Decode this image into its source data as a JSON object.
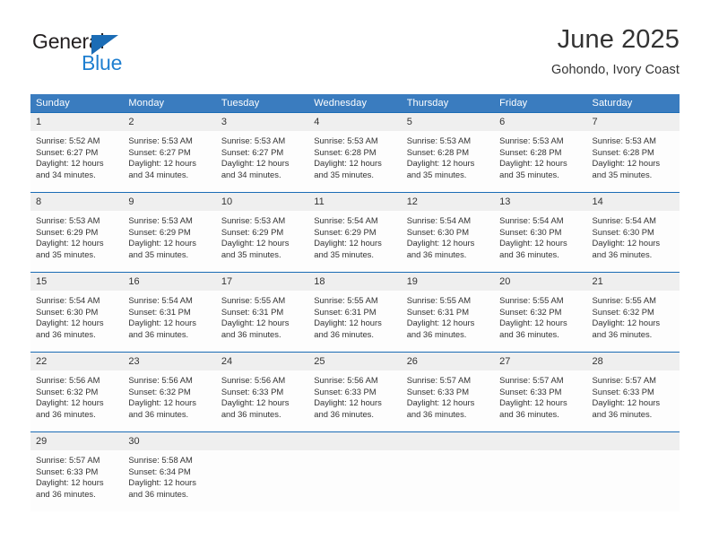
{
  "brand": {
    "name_dark": "General",
    "name_blue": "Blue",
    "accent_blue": "#1f7fd0",
    "triangle_blue": "#1b6cb5"
  },
  "header": {
    "title": "June 2025",
    "subtitle": "Gohondo, Ivory Coast"
  },
  "theme": {
    "header_row_bg": "#3a7cbf",
    "daynum_bg": "#efefef",
    "divider": "#1b6cb5",
    "text": "#333333"
  },
  "weekday_headers": [
    "Sunday",
    "Monday",
    "Tuesday",
    "Wednesday",
    "Thursday",
    "Friday",
    "Saturday"
  ],
  "weeks": [
    [
      {
        "day": "1",
        "sunrise": "Sunrise: 5:52 AM",
        "sunset": "Sunset: 6:27 PM",
        "daylight_line1": "Daylight: 12 hours",
        "daylight_line2": "and 34 minutes."
      },
      {
        "day": "2",
        "sunrise": "Sunrise: 5:53 AM",
        "sunset": "Sunset: 6:27 PM",
        "daylight_line1": "Daylight: 12 hours",
        "daylight_line2": "and 34 minutes."
      },
      {
        "day": "3",
        "sunrise": "Sunrise: 5:53 AM",
        "sunset": "Sunset: 6:27 PM",
        "daylight_line1": "Daylight: 12 hours",
        "daylight_line2": "and 34 minutes."
      },
      {
        "day": "4",
        "sunrise": "Sunrise: 5:53 AM",
        "sunset": "Sunset: 6:28 PM",
        "daylight_line1": "Daylight: 12 hours",
        "daylight_line2": "and 35 minutes."
      },
      {
        "day": "5",
        "sunrise": "Sunrise: 5:53 AM",
        "sunset": "Sunset: 6:28 PM",
        "daylight_line1": "Daylight: 12 hours",
        "daylight_line2": "and 35 minutes."
      },
      {
        "day": "6",
        "sunrise": "Sunrise: 5:53 AM",
        "sunset": "Sunset: 6:28 PM",
        "daylight_line1": "Daylight: 12 hours",
        "daylight_line2": "and 35 minutes."
      },
      {
        "day": "7",
        "sunrise": "Sunrise: 5:53 AM",
        "sunset": "Sunset: 6:28 PM",
        "daylight_line1": "Daylight: 12 hours",
        "daylight_line2": "and 35 minutes."
      }
    ],
    [
      {
        "day": "8",
        "sunrise": "Sunrise: 5:53 AM",
        "sunset": "Sunset: 6:29 PM",
        "daylight_line1": "Daylight: 12 hours",
        "daylight_line2": "and 35 minutes."
      },
      {
        "day": "9",
        "sunrise": "Sunrise: 5:53 AM",
        "sunset": "Sunset: 6:29 PM",
        "daylight_line1": "Daylight: 12 hours",
        "daylight_line2": "and 35 minutes."
      },
      {
        "day": "10",
        "sunrise": "Sunrise: 5:53 AM",
        "sunset": "Sunset: 6:29 PM",
        "daylight_line1": "Daylight: 12 hours",
        "daylight_line2": "and 35 minutes."
      },
      {
        "day": "11",
        "sunrise": "Sunrise: 5:54 AM",
        "sunset": "Sunset: 6:29 PM",
        "daylight_line1": "Daylight: 12 hours",
        "daylight_line2": "and 35 minutes."
      },
      {
        "day": "12",
        "sunrise": "Sunrise: 5:54 AM",
        "sunset": "Sunset: 6:30 PM",
        "daylight_line1": "Daylight: 12 hours",
        "daylight_line2": "and 36 minutes."
      },
      {
        "day": "13",
        "sunrise": "Sunrise: 5:54 AM",
        "sunset": "Sunset: 6:30 PM",
        "daylight_line1": "Daylight: 12 hours",
        "daylight_line2": "and 36 minutes."
      },
      {
        "day": "14",
        "sunrise": "Sunrise: 5:54 AM",
        "sunset": "Sunset: 6:30 PM",
        "daylight_line1": "Daylight: 12 hours",
        "daylight_line2": "and 36 minutes."
      }
    ],
    [
      {
        "day": "15",
        "sunrise": "Sunrise: 5:54 AM",
        "sunset": "Sunset: 6:30 PM",
        "daylight_line1": "Daylight: 12 hours",
        "daylight_line2": "and 36 minutes."
      },
      {
        "day": "16",
        "sunrise": "Sunrise: 5:54 AM",
        "sunset": "Sunset: 6:31 PM",
        "daylight_line1": "Daylight: 12 hours",
        "daylight_line2": "and 36 minutes."
      },
      {
        "day": "17",
        "sunrise": "Sunrise: 5:55 AM",
        "sunset": "Sunset: 6:31 PM",
        "daylight_line1": "Daylight: 12 hours",
        "daylight_line2": "and 36 minutes."
      },
      {
        "day": "18",
        "sunrise": "Sunrise: 5:55 AM",
        "sunset": "Sunset: 6:31 PM",
        "daylight_line1": "Daylight: 12 hours",
        "daylight_line2": "and 36 minutes."
      },
      {
        "day": "19",
        "sunrise": "Sunrise: 5:55 AM",
        "sunset": "Sunset: 6:31 PM",
        "daylight_line1": "Daylight: 12 hours",
        "daylight_line2": "and 36 minutes."
      },
      {
        "day": "20",
        "sunrise": "Sunrise: 5:55 AM",
        "sunset": "Sunset: 6:32 PM",
        "daylight_line1": "Daylight: 12 hours",
        "daylight_line2": "and 36 minutes."
      },
      {
        "day": "21",
        "sunrise": "Sunrise: 5:55 AM",
        "sunset": "Sunset: 6:32 PM",
        "daylight_line1": "Daylight: 12 hours",
        "daylight_line2": "and 36 minutes."
      }
    ],
    [
      {
        "day": "22",
        "sunrise": "Sunrise: 5:56 AM",
        "sunset": "Sunset: 6:32 PM",
        "daylight_line1": "Daylight: 12 hours",
        "daylight_line2": "and 36 minutes."
      },
      {
        "day": "23",
        "sunrise": "Sunrise: 5:56 AM",
        "sunset": "Sunset: 6:32 PM",
        "daylight_line1": "Daylight: 12 hours",
        "daylight_line2": "and 36 minutes."
      },
      {
        "day": "24",
        "sunrise": "Sunrise: 5:56 AM",
        "sunset": "Sunset: 6:33 PM",
        "daylight_line1": "Daylight: 12 hours",
        "daylight_line2": "and 36 minutes."
      },
      {
        "day": "25",
        "sunrise": "Sunrise: 5:56 AM",
        "sunset": "Sunset: 6:33 PM",
        "daylight_line1": "Daylight: 12 hours",
        "daylight_line2": "and 36 minutes."
      },
      {
        "day": "26",
        "sunrise": "Sunrise: 5:57 AM",
        "sunset": "Sunset: 6:33 PM",
        "daylight_line1": "Daylight: 12 hours",
        "daylight_line2": "and 36 minutes."
      },
      {
        "day": "27",
        "sunrise": "Sunrise: 5:57 AM",
        "sunset": "Sunset: 6:33 PM",
        "daylight_line1": "Daylight: 12 hours",
        "daylight_line2": "and 36 minutes."
      },
      {
        "day": "28",
        "sunrise": "Sunrise: 5:57 AM",
        "sunset": "Sunset: 6:33 PM",
        "daylight_line1": "Daylight: 12 hours",
        "daylight_line2": "and 36 minutes."
      }
    ],
    [
      {
        "day": "29",
        "sunrise": "Sunrise: 5:57 AM",
        "sunset": "Sunset: 6:33 PM",
        "daylight_line1": "Daylight: 12 hours",
        "daylight_line2": "and 36 minutes."
      },
      {
        "day": "30",
        "sunrise": "Sunrise: 5:58 AM",
        "sunset": "Sunset: 6:34 PM",
        "daylight_line1": "Daylight: 12 hours",
        "daylight_line2": "and 36 minutes."
      },
      {
        "day": "",
        "sunrise": "",
        "sunset": "",
        "daylight_line1": "",
        "daylight_line2": ""
      },
      {
        "day": "",
        "sunrise": "",
        "sunset": "",
        "daylight_line1": "",
        "daylight_line2": ""
      },
      {
        "day": "",
        "sunrise": "",
        "sunset": "",
        "daylight_line1": "",
        "daylight_line2": ""
      },
      {
        "day": "",
        "sunrise": "",
        "sunset": "",
        "daylight_line1": "",
        "daylight_line2": ""
      },
      {
        "day": "",
        "sunrise": "",
        "sunset": "",
        "daylight_line1": "",
        "daylight_line2": ""
      }
    ]
  ]
}
